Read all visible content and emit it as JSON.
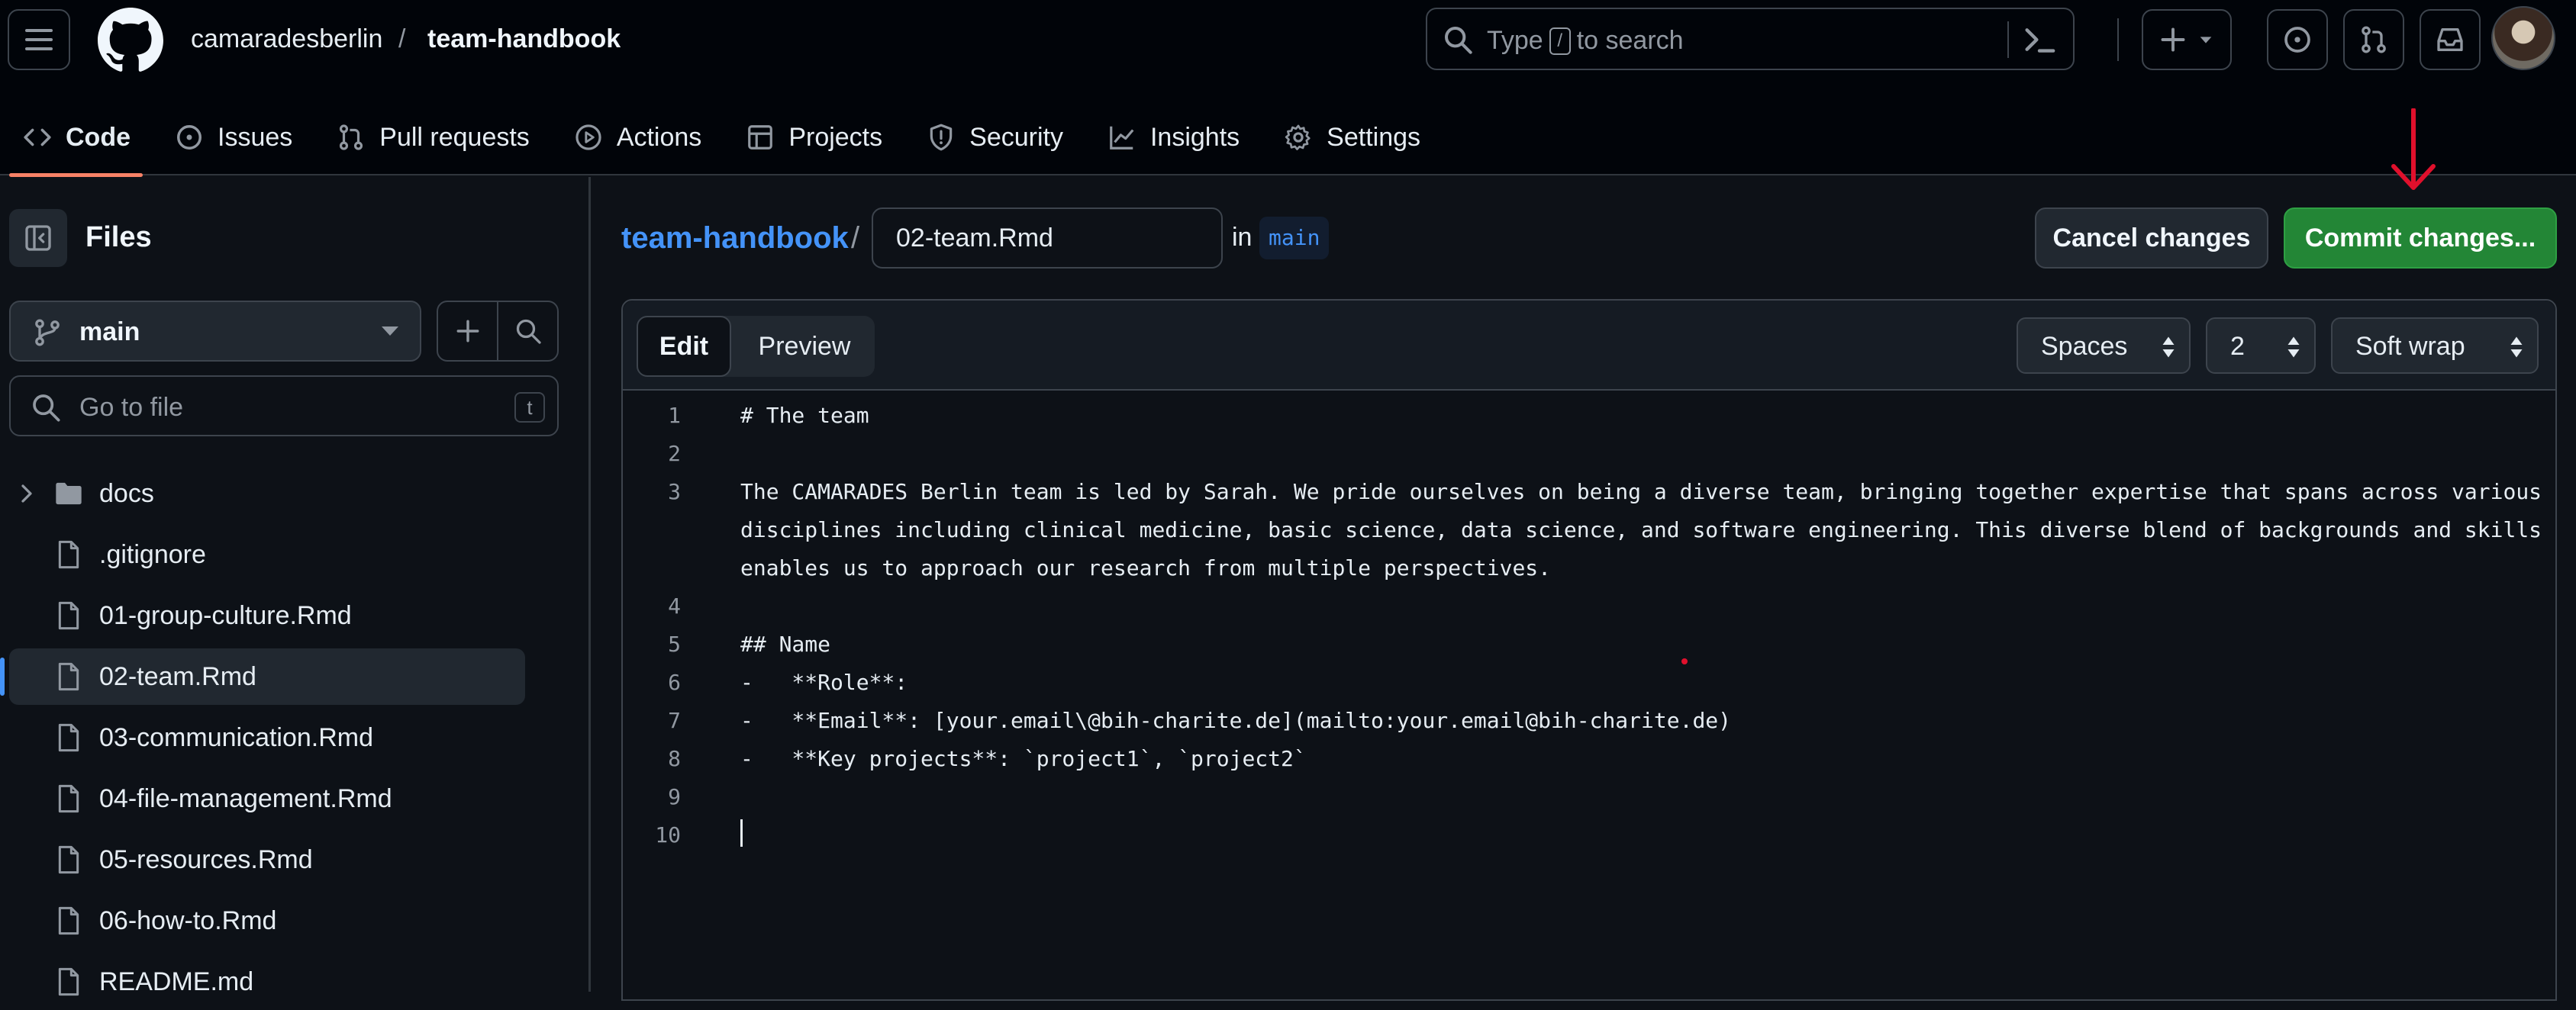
{
  "header": {
    "owner": "camaradesberlin",
    "separator": "/",
    "repo": "team-handbook",
    "search_prefix": "Type",
    "search_key": "/",
    "search_suffix": "to search"
  },
  "tabs": [
    {
      "label": "Code",
      "icon": "code-icon",
      "active": true
    },
    {
      "label": "Issues",
      "icon": "issue-circle-icon"
    },
    {
      "label": "Pull requests",
      "icon": "pull-request-icon"
    },
    {
      "label": "Actions",
      "icon": "play-icon"
    },
    {
      "label": "Projects",
      "icon": "table-icon"
    },
    {
      "label": "Security",
      "icon": "shield-icon"
    },
    {
      "label": "Insights",
      "icon": "graph-icon"
    },
    {
      "label": "Settings",
      "icon": "gear-icon"
    }
  ],
  "sidebar": {
    "title": "Files",
    "branch": "main",
    "goto_placeholder": "Go to file",
    "goto_key": "t",
    "items": [
      {
        "name": "docs",
        "type": "folder"
      },
      {
        "name": ".gitignore",
        "type": "file"
      },
      {
        "name": "01-group-culture.Rmd",
        "type": "file"
      },
      {
        "name": "02-team.Rmd",
        "type": "file",
        "active": true
      },
      {
        "name": "03-communication.Rmd",
        "type": "file"
      },
      {
        "name": "04-file-management.Rmd",
        "type": "file"
      },
      {
        "name": "05-resources.Rmd",
        "type": "file"
      },
      {
        "name": "06-how-to.Rmd",
        "type": "file"
      },
      {
        "name": "README.md",
        "type": "file"
      }
    ]
  },
  "editor": {
    "repo_link": "team-handbook",
    "slash": "/",
    "filename": "02-team.Rmd",
    "in_label": "in",
    "branch": "main",
    "cancel_label": "Cancel changes",
    "commit_label": "Commit changes...",
    "edit_tab": "Edit",
    "preview_tab": "Preview",
    "indent_mode": "Spaces",
    "indent_size": "2",
    "wrap_mode": "Soft wrap",
    "lines": [
      {
        "n": "1",
        "text": [
          "# The team"
        ]
      },
      {
        "n": "2",
        "text": [
          ""
        ]
      },
      {
        "n": "3",
        "text": [
          "The CAMARADES Berlin team is led by Sarah. We pride ourselves on being a diverse team, bringing together expertise that spans across various",
          "disciplines including clinical medicine, basic science, data science, and software engineering. This diverse blend of backgrounds and skills",
          "enables us to approach our research from multiple perspectives."
        ]
      },
      {
        "n": "4",
        "text": [
          ""
        ]
      },
      {
        "n": "5",
        "text": [
          "## Name"
        ]
      },
      {
        "n": "6",
        "text": [
          "-   **Role**:"
        ]
      },
      {
        "n": "7",
        "text": [
          "-   **Email**: [your.email\\@bih-charite.de](mailto:your.email@bih-charite.de)"
        ]
      },
      {
        "n": "8",
        "text": [
          "-   **Key projects**: `project1`, `project2`"
        ]
      },
      {
        "n": "9",
        "text": [
          ""
        ]
      },
      {
        "n": "10",
        "text": [
          ""
        ]
      }
    ]
  },
  "colors": {
    "accent_blue": "#4493f8",
    "commit_green": "#238636",
    "active_tab_underline": "#f78166",
    "annotation_red": "#e0102c"
  }
}
